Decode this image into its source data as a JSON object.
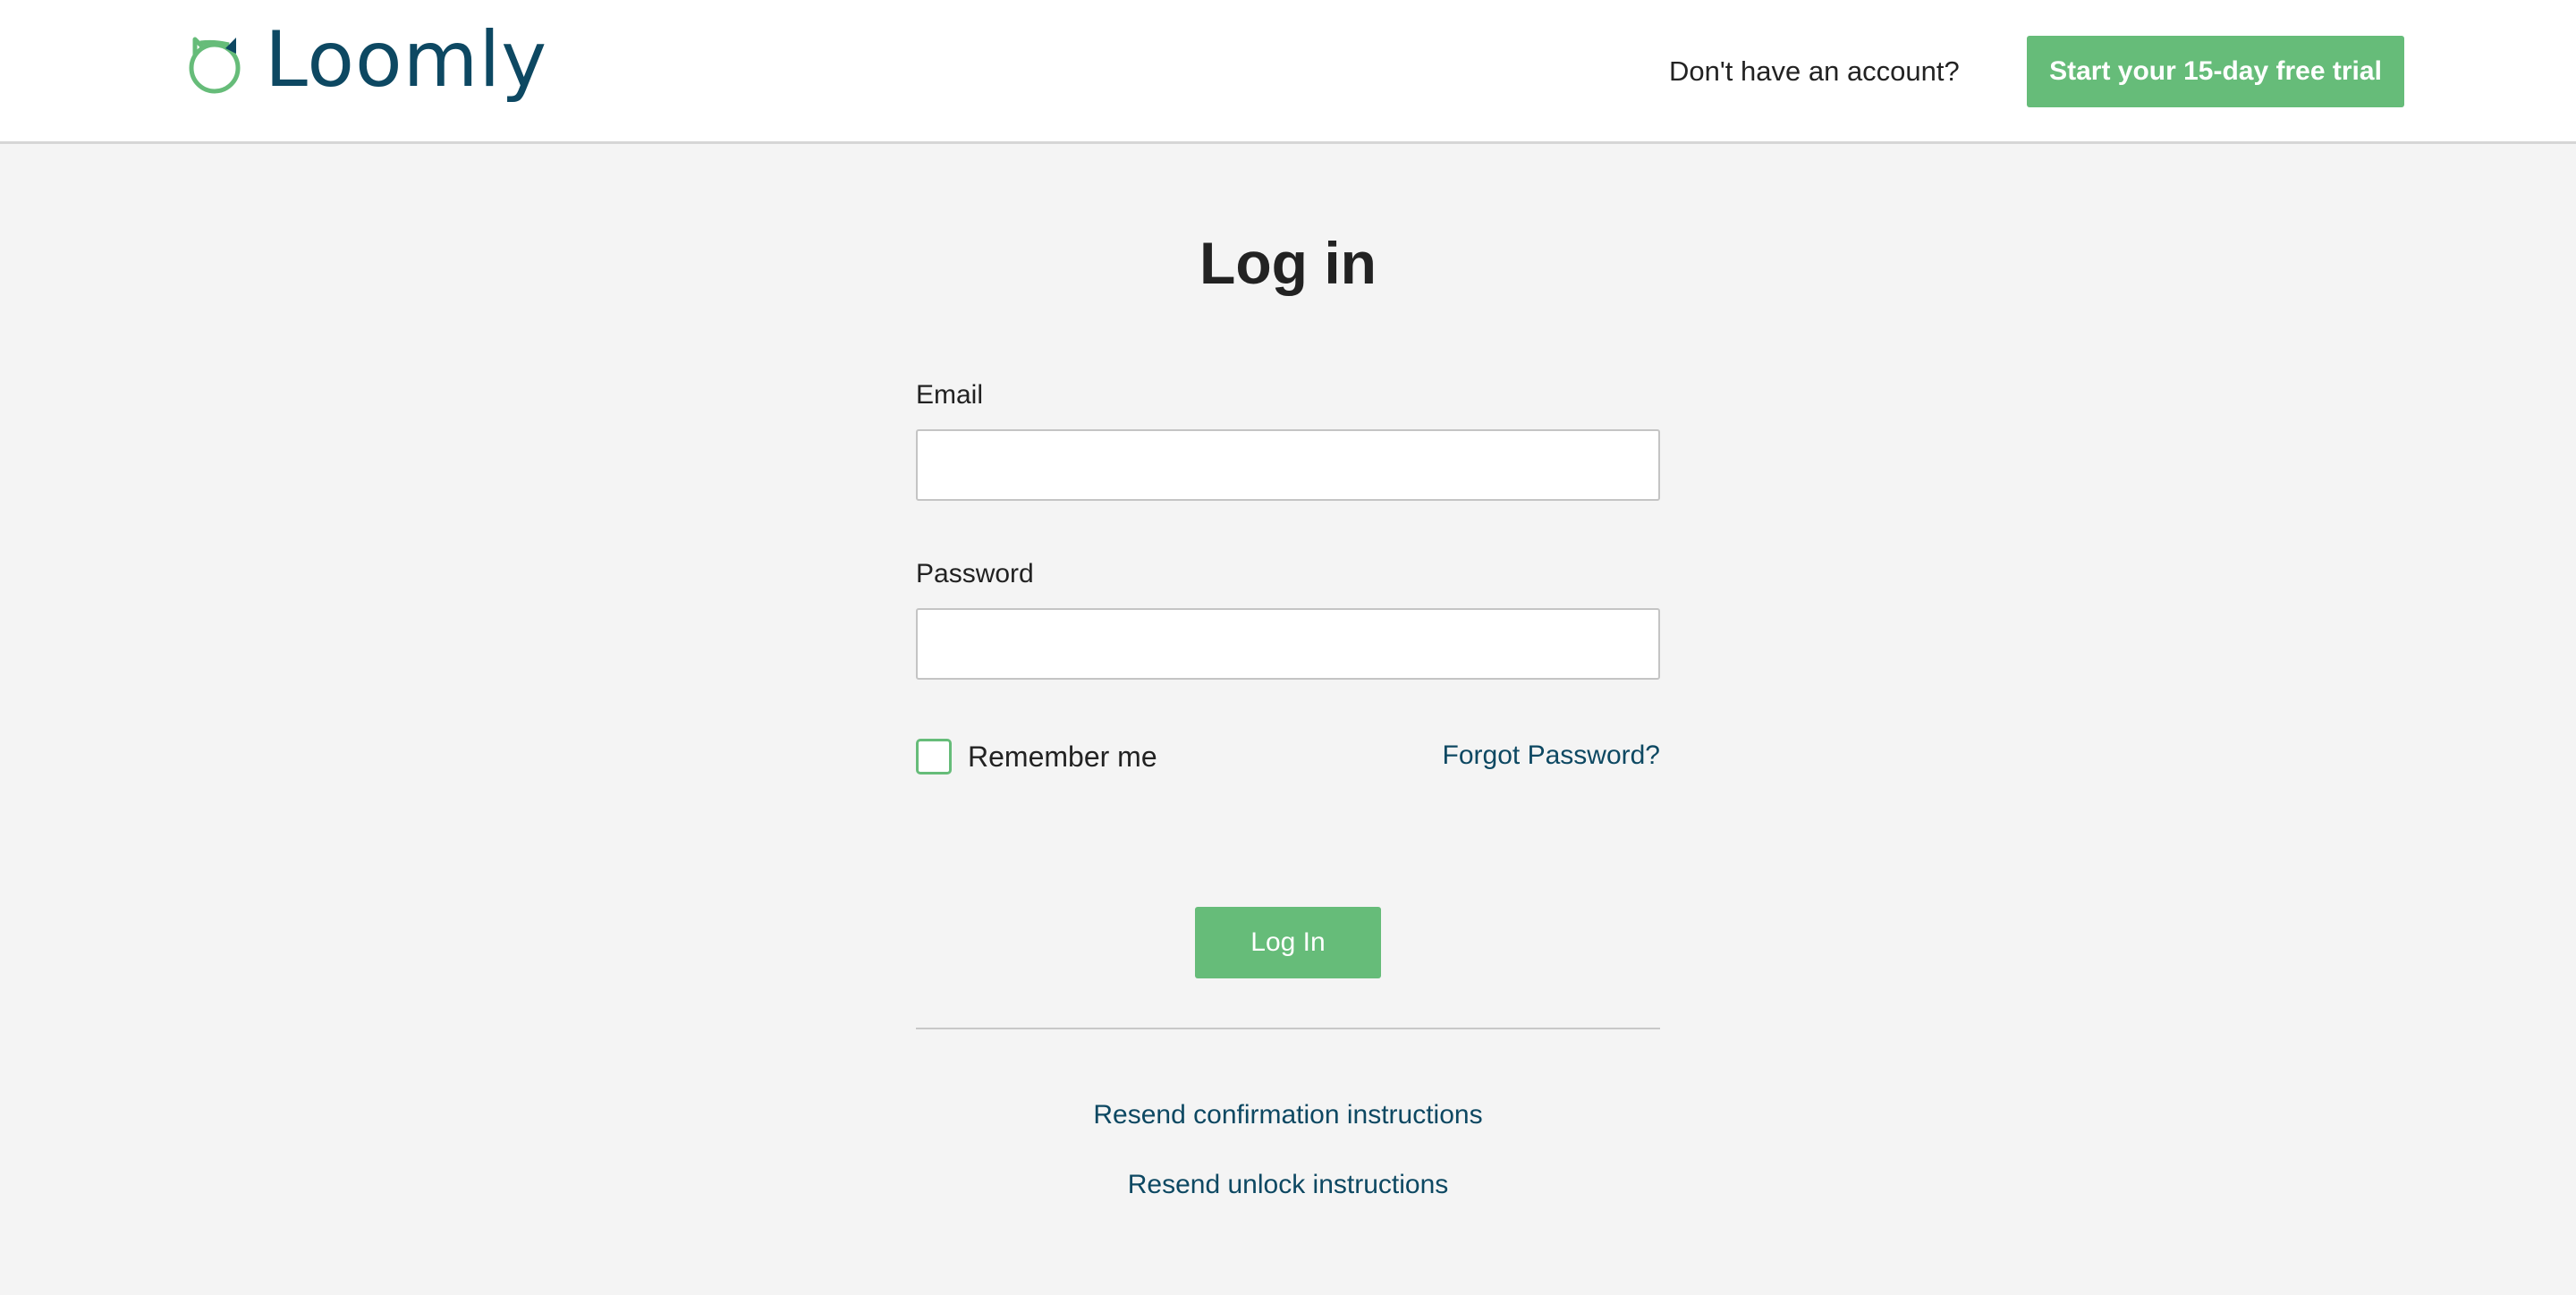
{
  "header": {
    "brand_name": "Loomly",
    "signup_prompt": "Don't have an account?",
    "trial_button_label": "Start your 15-day free trial"
  },
  "login": {
    "title": "Log in",
    "email_label": "Email",
    "email_value": "",
    "password_label": "Password",
    "password_value": "",
    "remember_label": "Remember me",
    "remember_checked": false,
    "forgot_link": "Forgot Password?",
    "submit_label": "Log In"
  },
  "footer_links": {
    "resend_confirmation": "Resend confirmation instructions",
    "resend_unlock": "Resend unlock instructions"
  },
  "colors": {
    "brand_green": "#66bc79",
    "brand_navy": "#0d4862",
    "background": "#f4f4f4"
  },
  "icons": {
    "logo": "loomly-owl-icon"
  }
}
